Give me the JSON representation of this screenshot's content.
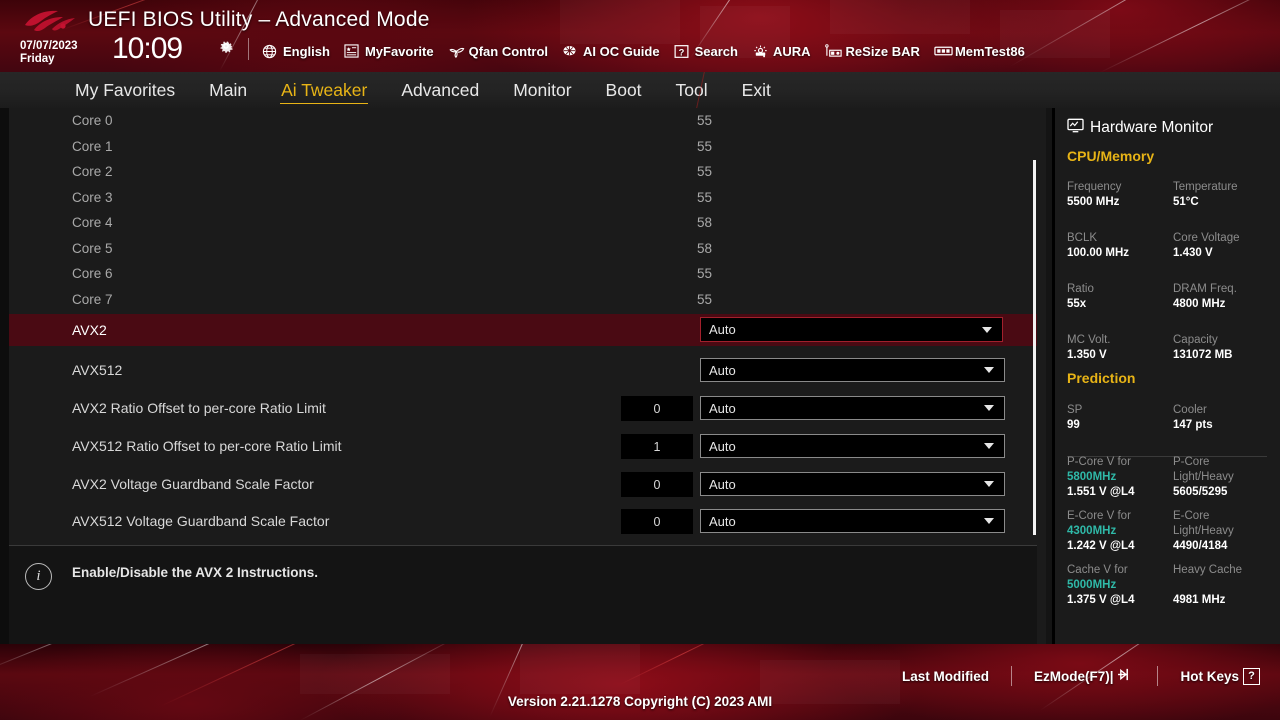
{
  "header": {
    "app_title": "UEFI BIOS Utility – Advanced Mode",
    "logo": "rog-logo",
    "date": "07/07/2023",
    "weekday": "Friday",
    "time": "10:09",
    "gear_icon": "gear-icon",
    "menu": [
      {
        "label": "English",
        "icon": "globe-icon"
      },
      {
        "label": "MyFavorite",
        "icon": "star-list-icon"
      },
      {
        "label": "Qfan Control",
        "icon": "fan-icon"
      },
      {
        "label": "AI OC Guide",
        "icon": "brain-icon"
      },
      {
        "label": "Search",
        "icon": "question-box-icon"
      },
      {
        "label": "AURA",
        "icon": "aura-lamp-icon"
      },
      {
        "label": "ReSize BAR",
        "icon": "resize-bar-icon"
      },
      {
        "label": "MemTest86",
        "icon": "memory-icon"
      }
    ]
  },
  "nav": {
    "tabs": [
      {
        "label": "My Favorites",
        "active": false
      },
      {
        "label": "Main",
        "active": false
      },
      {
        "label": "Ai Tweaker",
        "active": true
      },
      {
        "label": "Advanced",
        "active": false
      },
      {
        "label": "Monitor",
        "active": false
      },
      {
        "label": "Boot",
        "active": false
      },
      {
        "label": "Tool",
        "active": false
      },
      {
        "label": "Exit",
        "active": false
      }
    ]
  },
  "content": {
    "core_rows": [
      {
        "label": "Core 0",
        "value": "55"
      },
      {
        "label": "Core 1",
        "value": "55"
      },
      {
        "label": "Core 2",
        "value": "55"
      },
      {
        "label": "Core 3",
        "value": "55"
      },
      {
        "label": "Core 4",
        "value": "58"
      },
      {
        "label": "Core 5",
        "value": "58"
      },
      {
        "label": "Core 6",
        "value": "55"
      },
      {
        "label": "Core 7",
        "value": "55"
      }
    ],
    "settings": [
      {
        "label": "AVX2",
        "number": null,
        "dropdown": "Auto",
        "selected": true
      },
      {
        "label": "AVX512",
        "number": null,
        "dropdown": "Auto",
        "selected": false
      },
      {
        "label": "AVX2 Ratio Offset to per-core Ratio Limit",
        "number": "0",
        "dropdown": "Auto",
        "selected": false
      },
      {
        "label": "AVX512 Ratio Offset to per-core Ratio Limit",
        "number": "1",
        "dropdown": "Auto",
        "selected": false
      },
      {
        "label": "AVX2 Voltage Guardband Scale Factor",
        "number": "0",
        "dropdown": "Auto",
        "selected": false
      },
      {
        "label": "AVX512 Voltage Guardband Scale Factor",
        "number": "0",
        "dropdown": "Auto",
        "selected": false
      }
    ],
    "help": {
      "icon": "info-icon",
      "text": "Enable/Disable the AVX 2 Instructions."
    }
  },
  "hardware_monitor": {
    "title": "Hardware Monitor",
    "title_icon": "monitor-icon",
    "sections": [
      {
        "title": "CPU/Memory",
        "cells": [
          {
            "key": "Frequency",
            "value": "5500 MHz"
          },
          {
            "key": "Temperature",
            "value": "51°C"
          },
          {
            "key": "BCLK",
            "value": "100.00 MHz"
          },
          {
            "key": "Core Voltage",
            "value": "1.430 V"
          },
          {
            "key": "Ratio",
            "value": "55x"
          },
          {
            "key": "DRAM Freq.",
            "value": "4800 MHz"
          },
          {
            "key": "MC Volt.",
            "value": "1.350 V"
          },
          {
            "key": "Capacity",
            "value": "131072 MB"
          }
        ]
      },
      {
        "title": "Prediction",
        "cells": [
          {
            "key": "SP",
            "value": "99"
          },
          {
            "key": "Cooler",
            "value": "147 pts"
          }
        ],
        "prediction_rows": [
          {
            "left_key": "P-Core V for",
            "left_highlight": "5800MHz",
            "left_value": "1.551 V @L4",
            "right_key": "P-Core",
            "right_key2": "Light/Heavy",
            "right_value": "5605/5295"
          },
          {
            "left_key": "E-Core V for",
            "left_highlight": "4300MHz",
            "left_value": "1.242 V @L4",
            "right_key": "E-Core",
            "right_key2": "Light/Heavy",
            "right_value": "4490/4184"
          },
          {
            "left_key": "Cache V for",
            "left_highlight": "5000MHz",
            "left_value": "1.375 V @L4",
            "right_key": "Heavy Cache",
            "right_key2": "",
            "right_value": "4981 MHz"
          }
        ]
      }
    ]
  },
  "footer": {
    "last_modified": "Last Modified",
    "ezmode": "EzMode(F7)|",
    "hotkeys": "Hot Keys",
    "hotkeys_glyph": "?",
    "version": "Version 2.21.1278 Copyright (C) 2023 AMI"
  },
  "colors": {
    "accent_yellow": "#e8b416",
    "accent_teal": "#2fb9a8",
    "selection_red": "#4a0a13",
    "panel_bg": "#1b1b1b"
  }
}
